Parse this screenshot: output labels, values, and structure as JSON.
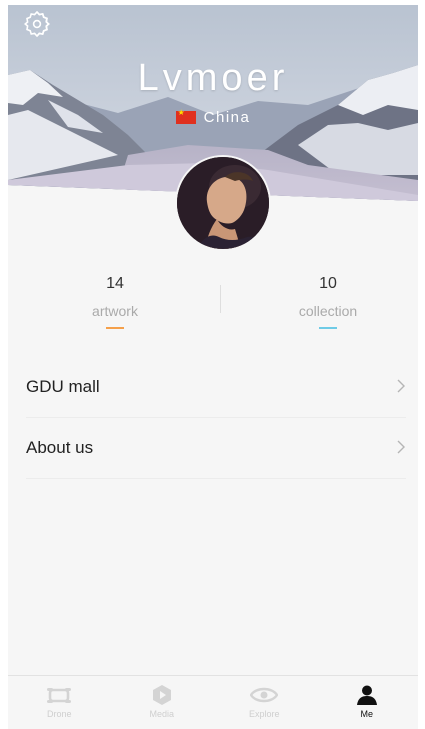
{
  "profile": {
    "name": "Lvmoer",
    "country": "China",
    "flag_icon": "china-flag-icon"
  },
  "header": {
    "settings_icon": "gear-icon"
  },
  "stats": {
    "artwork": {
      "count": "14",
      "label": "artwork",
      "accent": "#f5a04a"
    },
    "collection": {
      "count": "10",
      "label": "collection",
      "accent": "#6fcbe6"
    }
  },
  "menu": {
    "items": [
      {
        "label": "GDU mall",
        "chevron": ">"
      },
      {
        "label": "About us",
        "chevron": ">"
      }
    ]
  },
  "tabbar": {
    "tabs": [
      {
        "label": "Drone",
        "icon": "drone-icon",
        "active": false
      },
      {
        "label": "Media",
        "icon": "media-icon",
        "active": false
      },
      {
        "label": "Explore",
        "icon": "eye-icon",
        "active": false
      },
      {
        "label": "Me",
        "icon": "user-icon",
        "active": true
      }
    ]
  }
}
